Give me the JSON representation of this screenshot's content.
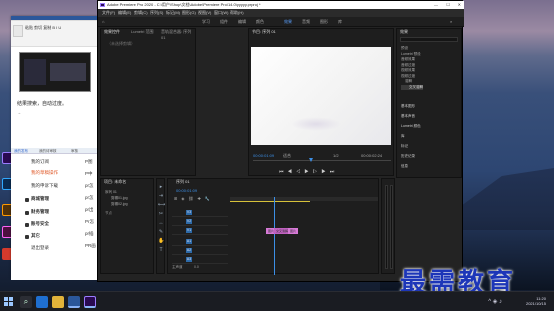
{
  "desktop_icons": [
    {
      "label": "Adobe Premiere Pro 2020",
      "color": "#2a0a52"
    },
    {
      "label": "Adobe Photoshop",
      "color": "#0a2b52"
    },
    {
      "label": "Adobe Illustrator",
      "color": "#523209"
    },
    {
      "label": "Adobe XD",
      "color": "#4d1040"
    },
    {
      "label": "SnipTool",
      "color": "#d53a2c"
    }
  ],
  "word": {
    "toolbar": "粘贴 剪切 复制 B I U",
    "heading": "结果搜索，自动过度。",
    "cursor_text": "→"
  },
  "web": {
    "tabs": [
      "我的发布",
      "我的待审核",
      "审核"
    ],
    "menu": [
      {
        "label": "我的订阅"
      },
      {
        "label": "我的草稿操作"
      },
      {
        "label": "我的申诉下载"
      },
      {
        "label": "商城管理"
      },
      {
        "label": "财务管理"
      },
      {
        "label": "账号安全"
      },
      {
        "label": "其它"
      },
      {
        "label": "退出登录"
      }
    ],
    "side_labels": [
      "P图",
      "P中",
      "pr怎",
      "pr怎",
      "pr出",
      "Pr怎",
      "pr插",
      "PR画"
    ]
  },
  "premiere": {
    "title": "Adobe Premiere Pro 2020 - C:\\用户\\Shop\\文档\\Adobe\\Premiere Pro\\14.0\\yyyyy.prproj *",
    "menu": [
      "文件(F)",
      "编辑(E)",
      "剪辑(C)",
      "序列(S)",
      "标记(M)",
      "图形(G)",
      "视图(V)",
      "窗口(W)",
      "帮助(H)"
    ],
    "workspaces": [
      "学习",
      "组件",
      "编辑",
      "颜色",
      "效果",
      "音频",
      "图形",
      "库"
    ],
    "active_workspace": "编辑",
    "source": {
      "tabs": [
        "效果控件",
        "Lumetri 范围",
        "音轨混合器: 序列 01"
      ],
      "note": "（未选择剪辑）"
    },
    "program": {
      "tab": "节目: 序列 01",
      "timecode": "00:00:01:09",
      "fit": "适合",
      "ratio": "1/2",
      "duration": "00:00:02:24"
    },
    "effects": {
      "tab": "效果",
      "items": [
        "预设",
        "Lumetri 预设",
        "音频效果",
        "音频过渡",
        "视频效果",
        "视频过渡",
        "溶解"
      ],
      "selected": "交叉溶解"
    },
    "right_panels": [
      "基本图形",
      "基本声音",
      "Lumetri 颜色",
      "库",
      "标记",
      "历史记录",
      "信息"
    ],
    "project": {
      "tab": "项目: 未命名",
      "items": [
        "序列 01",
        "剪辑01.jpg",
        "剪辑02.jpg"
      ],
      "search_label": "节点"
    },
    "timeline": {
      "tab": "序列 01",
      "timecode": "00:00:01:09",
      "tracks": [
        {
          "name": "V3"
        },
        {
          "name": "V2"
        },
        {
          "name": "V1"
        },
        {
          "name": "A1"
        },
        {
          "name": "A2"
        },
        {
          "name": "A3"
        }
      ],
      "master_label": "主声道",
      "master_value": "0.0",
      "clips": [
        {
          "label": "图片",
          "track": "V1"
        },
        {
          "label": "交叉溶解",
          "track": "V1"
        },
        {
          "label": "图片",
          "track": "V1"
        }
      ]
    }
  },
  "taskbar": {
    "time": "11:20",
    "date": "2021/10/15",
    "pinned": [
      "Windows Search",
      "Edge",
      "File Explorer",
      "Word",
      "Premiere Pro"
    ]
  },
  "watermark": "最需教育"
}
